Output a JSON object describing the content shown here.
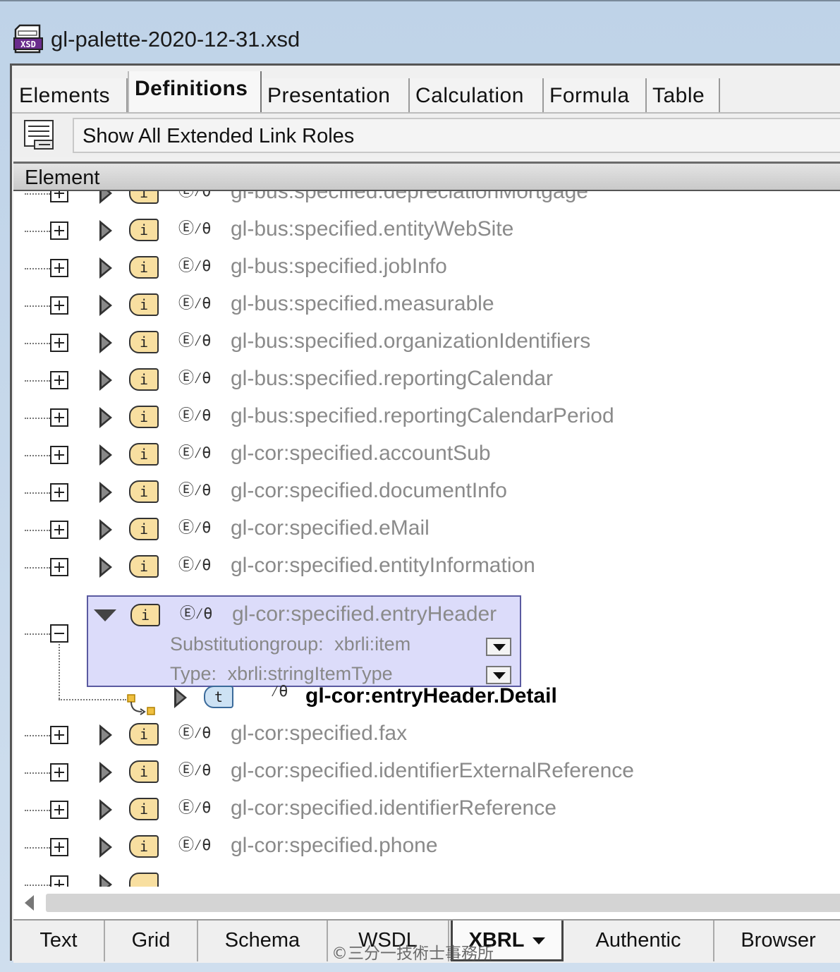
{
  "window": {
    "title": "gl-palette-2020-12-31.xsd",
    "file_icon_text": "XSD"
  },
  "tabs": [
    {
      "label": "Elements",
      "active": false
    },
    {
      "label": "Definitions",
      "active": true
    },
    {
      "label": "Presentation",
      "active": false
    },
    {
      "label": "Calculation",
      "active": false
    },
    {
      "label": "Formula",
      "active": false
    },
    {
      "label": "Table",
      "active": false
    }
  ],
  "toolbar": {
    "link_roles_label": "Show All Extended Link Roles"
  },
  "column_header": {
    "label": "Element"
  },
  "property_icons": "Ⓔ⁄θ",
  "rows": [
    {
      "name": "gl-bus:specified.depreciationMortgage",
      "type_icon": "i"
    },
    {
      "name": "gl-bus:specified.entityWebSite",
      "type_icon": "i"
    },
    {
      "name": "gl-bus:specified.jobInfo",
      "type_icon": "i"
    },
    {
      "name": "gl-bus:specified.measurable",
      "type_icon": "i"
    },
    {
      "name": "gl-bus:specified.organizationIdentifiers",
      "type_icon": "i"
    },
    {
      "name": "gl-bus:specified.reportingCalendar",
      "type_icon": "i"
    },
    {
      "name": "gl-bus:specified.reportingCalendarPeriod",
      "type_icon": "i"
    },
    {
      "name": "gl-cor:specified.accountSub",
      "type_icon": "i"
    },
    {
      "name": "gl-cor:specified.documentInfo",
      "type_icon": "i"
    },
    {
      "name": "gl-cor:specified.eMail",
      "type_icon": "i"
    },
    {
      "name": "gl-cor:specified.entityInformation",
      "type_icon": "i"
    }
  ],
  "expanded": {
    "name": "gl-cor:specified.entryHeader",
    "type_icon": "i",
    "substitution_group_label": "Substitutiongroup:",
    "substitution_group_value": "xbrli:item",
    "type_label": "Type:",
    "type_value": "xbrli:stringItemType",
    "child": {
      "name": "gl-cor:entryHeader.Detail",
      "type_icon": "t",
      "props": "⁄θ"
    }
  },
  "rows_after": [
    {
      "name": "gl-cor:specified.fax",
      "type_icon": "i"
    },
    {
      "name": "gl-cor:specified.identifierExternalReference",
      "type_icon": "i"
    },
    {
      "name": "gl-cor:specified.identifierReference",
      "type_icon": "i"
    },
    {
      "name": "gl-cor:specified.phone",
      "type_icon": "i"
    }
  ],
  "view_tabs": [
    {
      "label": "Text"
    },
    {
      "label": "Grid"
    },
    {
      "label": "Schema"
    },
    {
      "label": "WSDL"
    },
    {
      "label": "XBRL",
      "active": true
    },
    {
      "label": "Authentic"
    },
    {
      "label": "Browser"
    }
  ],
  "watermark": "©三分一技術士事務所"
}
